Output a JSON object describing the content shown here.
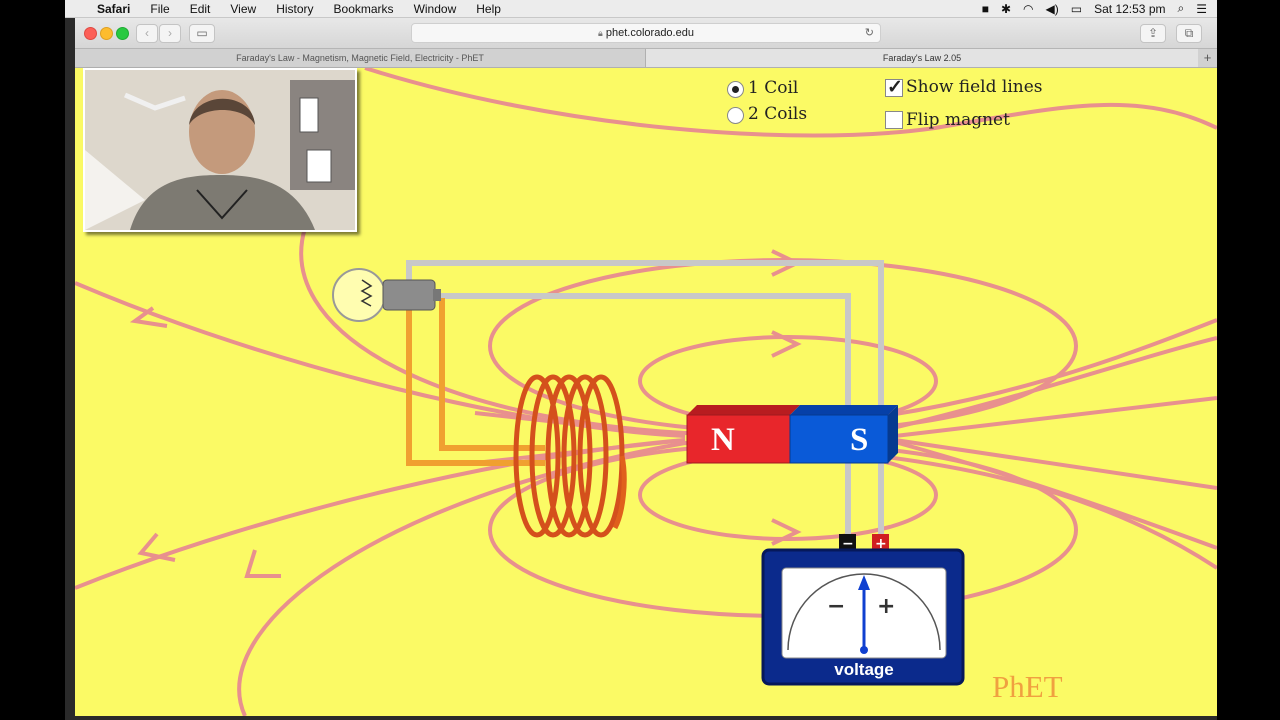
{
  "menubar": {
    "app": "Safari",
    "items": [
      "File",
      "Edit",
      "View",
      "History",
      "Bookmarks",
      "Window",
      "Help"
    ],
    "clock": "Sat 12:53 pm"
  },
  "browser": {
    "url": "phet.colorado.edu",
    "tabs": [
      "Faraday's Law - Magnetism, Magnetic Field, Electricity - PhET",
      "Faraday's Law 2.05"
    ]
  },
  "sim": {
    "coil_options": [
      "1 Coil",
      "2 Coils"
    ],
    "selected_coil": "1 Coil",
    "show_field_lines": {
      "label": "Show field lines",
      "checked": true
    },
    "flip_magnet": {
      "label": "Flip magnet",
      "checked": false
    },
    "magnet": {
      "north": "N",
      "south": "S"
    },
    "voltmeter": {
      "label": "voltage",
      "minus": "−",
      "plus": "+",
      "reading": 0
    },
    "logo": "PhET"
  },
  "colors": {
    "background": "#fbfa65",
    "field_lines": "#e8908e",
    "north": "#e8262b",
    "south": "#0a5ad8",
    "coil": "#d4501c",
    "wire": "#c8c8c8",
    "meter": "#0b2a8c"
  }
}
